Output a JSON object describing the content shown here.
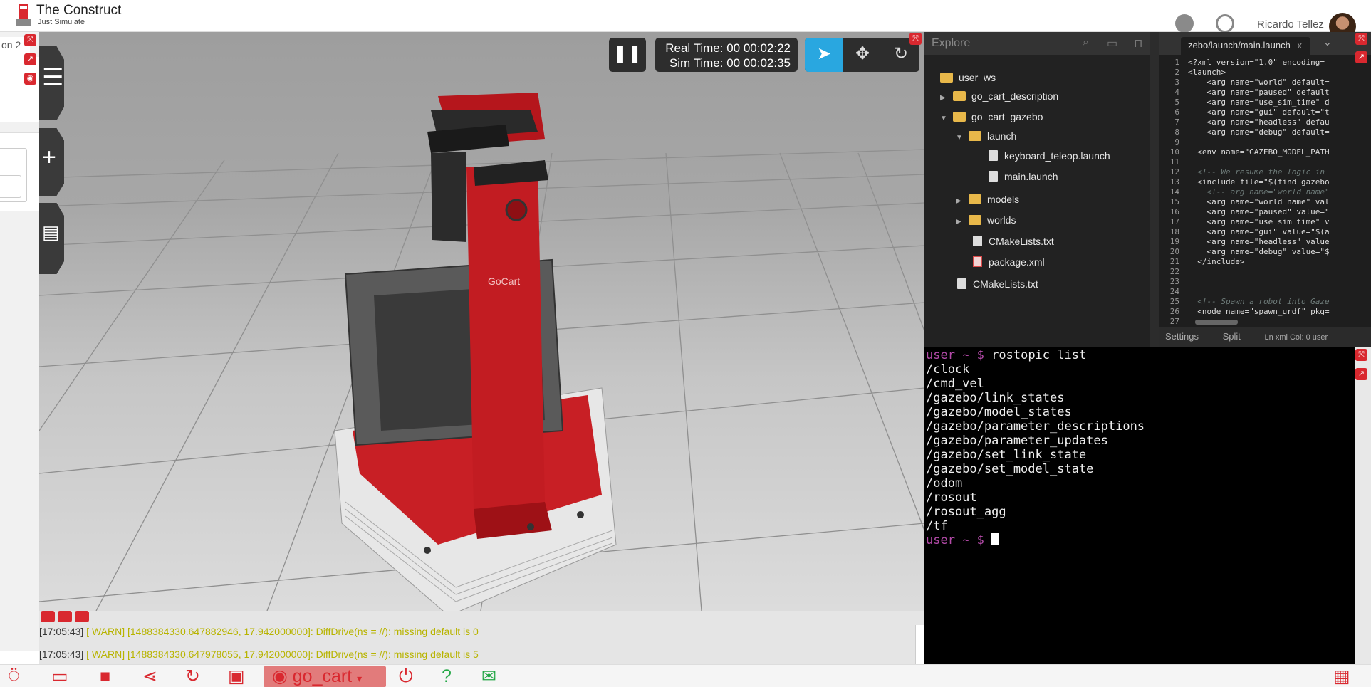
{
  "brand": {
    "title": "The Construct",
    "tagline": "Just Simulate"
  },
  "user": {
    "name": "Ricardo Tellez"
  },
  "left_panel": {
    "tab_peek": "on 2"
  },
  "sim": {
    "real_time_label": "Real Time: 00 00:02:22",
    "sim_time_label": "Sim Time: 00 00:02:35",
    "robot_logo_text": "GoCart"
  },
  "log": [
    {
      "time": "[17:05:43]",
      "msg": " [ WARN] [1488384330.647882946, 17.942000000]: DiffDrive(ns = //): missing default is 0"
    },
    {
      "time": "[17:05:43]",
      "msg": " [ WARN] [1488384330.647978055, 17.942000000]: DiffDrive(ns = //): missing default is 5"
    }
  ],
  "explorer": {
    "title": "Explore",
    "tree": [
      {
        "label": "user_ws",
        "type": "folder",
        "arrow": ""
      },
      {
        "label": "go_cart_description",
        "type": "folder",
        "arrow": "▶"
      },
      {
        "label": "go_cart_gazebo",
        "type": "folder",
        "arrow": "▼"
      },
      {
        "label": "launch",
        "type": "folder",
        "arrow": "▼"
      },
      {
        "label": "keyboard_teleop.launch",
        "type": "file",
        "arrow": ""
      },
      {
        "label": "main.launch",
        "type": "file",
        "arrow": ""
      },
      {
        "label": "models",
        "type": "folder",
        "arrow": "▶"
      },
      {
        "label": "worlds",
        "type": "folder",
        "arrow": "▶"
      },
      {
        "label": "CMakeLists.txt",
        "type": "file",
        "arrow": ""
      },
      {
        "label": "package.xml",
        "type": "xml",
        "arrow": ""
      },
      {
        "label": "CMakeLists.txt",
        "type": "file",
        "arrow": ""
      }
    ]
  },
  "editor": {
    "tab_label": "zebo/launch/main.launch",
    "tab_close": "x",
    "lines": [
      {
        "n": "1",
        "text": "<?xml version=\"1.0\" encoding=",
        "cmt": false
      },
      {
        "n": "2",
        "text": "<launch>",
        "cmt": false
      },
      {
        "n": "3",
        "text": "    <arg name=\"world\" default=",
        "cmt": false
      },
      {
        "n": "4",
        "text": "    <arg name=\"paused\" default",
        "cmt": false
      },
      {
        "n": "5",
        "text": "    <arg name=\"use_sim_time\" d",
        "cmt": false
      },
      {
        "n": "6",
        "text": "    <arg name=\"gui\" default=\"t",
        "cmt": false
      },
      {
        "n": "7",
        "text": "    <arg name=\"headless\" defau",
        "cmt": false
      },
      {
        "n": "8",
        "text": "    <arg name=\"debug\" default=",
        "cmt": false
      },
      {
        "n": "9",
        "text": "",
        "cmt": false
      },
      {
        "n": "10",
        "text": "  <env name=\"GAZEBO_MODEL_PATH",
        "cmt": false
      },
      {
        "n": "11",
        "text": "",
        "cmt": false
      },
      {
        "n": "12",
        "text": "  <!-- We resume the logic in",
        "cmt": true
      },
      {
        "n": "13",
        "text": "  <include file=\"$(find gazebo",
        "cmt": false
      },
      {
        "n": "14",
        "text": "    <!-- arg name=\"world_name\"",
        "cmt": true
      },
      {
        "n": "15",
        "text": "    <arg name=\"world_name\" val",
        "cmt": false
      },
      {
        "n": "16",
        "text": "    <arg name=\"paused\" value=\"",
        "cmt": false
      },
      {
        "n": "17",
        "text": "    <arg name=\"use_sim_time\" v",
        "cmt": false
      },
      {
        "n": "18",
        "text": "    <arg name=\"gui\" value=\"$(a",
        "cmt": false
      },
      {
        "n": "19",
        "text": "    <arg name=\"headless\" value",
        "cmt": false
      },
      {
        "n": "20",
        "text": "    <arg name=\"debug\" value=\"$",
        "cmt": false
      },
      {
        "n": "21",
        "text": "  </include>",
        "cmt": false
      },
      {
        "n": "22",
        "text": "",
        "cmt": false
      },
      {
        "n": "23",
        "text": "",
        "cmt": false
      },
      {
        "n": "24",
        "text": "",
        "cmt": false
      },
      {
        "n": "25",
        "text": "  <!-- Spawn a robot into Gaze",
        "cmt": true
      },
      {
        "n": "26",
        "text": "  <node name=\"spawn_urdf\" pkg=",
        "cmt": false
      },
      {
        "n": "27",
        "text": "",
        "cmt": false
      }
    ],
    "status": {
      "settings": "Settings",
      "split": "Split",
      "pos": "Ln xml Col: 0 user"
    }
  },
  "terminal": {
    "prompt_user": "user",
    "prompt_rest": " ~ $ ",
    "command": "rostopic list",
    "output": [
      "/clock",
      "/cmd_vel",
      "/gazebo/link_states",
      "/gazebo/model_states",
      "/gazebo/parameter_descriptions",
      "/gazebo/parameter_updates",
      "/gazebo/set_link_state",
      "/gazebo/set_model_state",
      "/odom",
      "/rosout",
      "/rosout_agg",
      "/tf"
    ]
  },
  "bottom": {
    "env_label": "go_cart",
    "env_caret": "▾"
  },
  "colors": {
    "accent_red": "#d9282f",
    "select_blue": "#29a7e0",
    "prompt_purple": "#b34aa8",
    "warn_yellow": "#b8b400"
  }
}
